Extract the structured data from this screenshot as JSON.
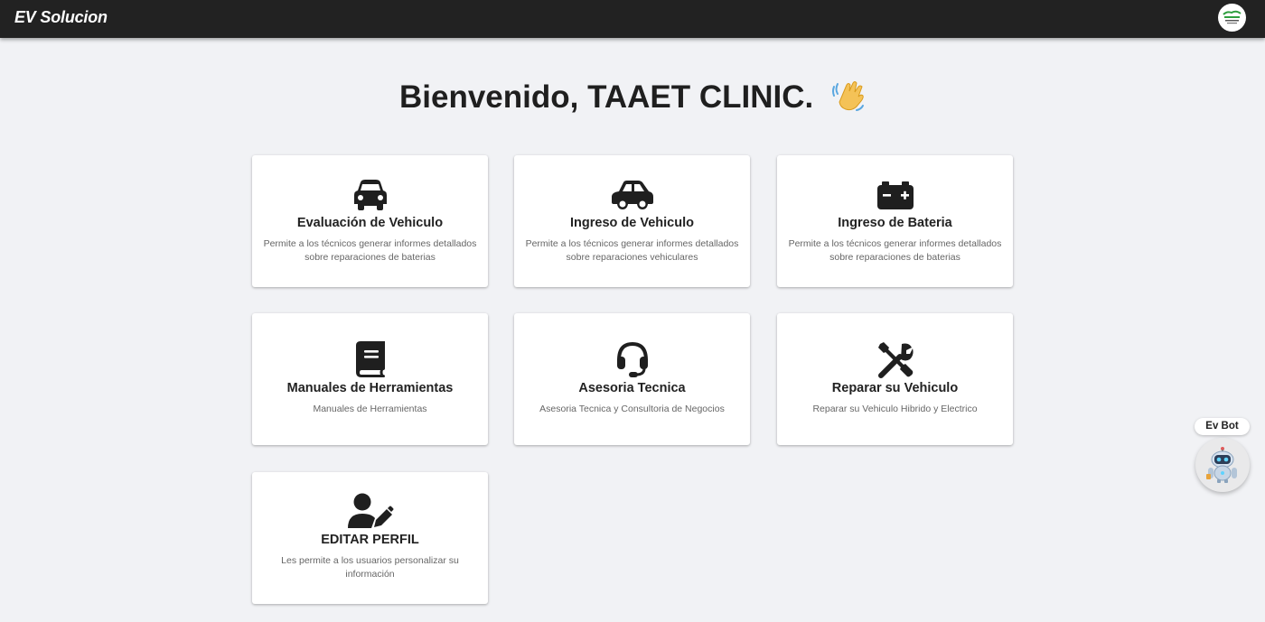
{
  "app": {
    "brand": "EV Solucion"
  },
  "welcome": {
    "text": "Bienvenido, TAAET CLINIC."
  },
  "cards": [
    {
      "icon": "car-front-icon",
      "title": "Evaluación de Vehiculo",
      "description": "Permite a los técnicos generar informes detallados sobre reparaciones de baterias"
    },
    {
      "icon": "car-side-icon",
      "title": "Ingreso de Vehiculo",
      "description": "Permite a los técnicos generar informes detallados sobre reparaciones vehiculares"
    },
    {
      "icon": "battery-icon",
      "title": "Ingreso de Bateria",
      "description": "Permite a los técnicos generar informes detallados sobre reparaciones de baterias"
    },
    {
      "icon": "book-icon",
      "title": "Manuales de Herramientas",
      "description": "Manuales de Herramientas"
    },
    {
      "icon": "headset-icon",
      "title": "Asesoria Tecnica",
      "description": "Asesoria Tecnica y Consultoria de Negocios"
    },
    {
      "icon": "tools-icon",
      "title": "Reparar su Vehiculo",
      "description": "Reparar su Vehiculo Hibrido y Electrico"
    },
    {
      "icon": "user-edit-icon",
      "title": "EDITAR PERFIL",
      "description": "Les permite a los usuarios personalizar su información"
    }
  ],
  "chatbot": {
    "label": "Ev Bot"
  },
  "colors": {
    "topbar": "#222222",
    "background": "#f1f2f5",
    "card": "#ffffff",
    "icon": "#1f1f1f",
    "wave": "#f4c257"
  }
}
